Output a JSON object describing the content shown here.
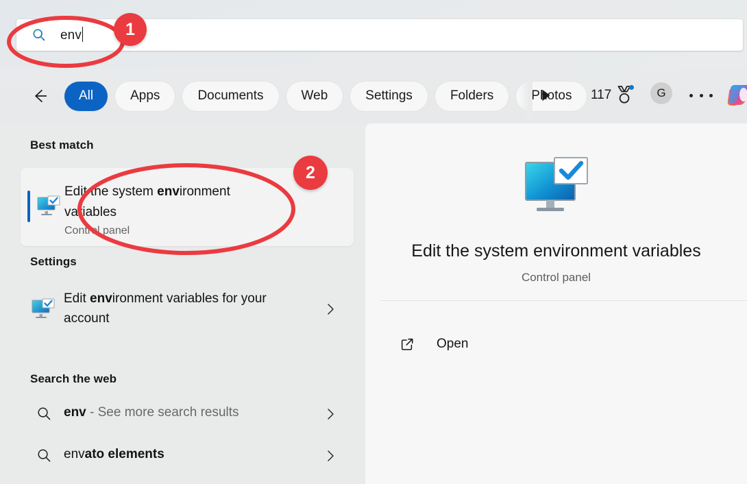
{
  "search": {
    "icon": "search-icon",
    "value": "env",
    "caret_visible": true
  },
  "tabs": {
    "back_icon": "back-arrow-icon",
    "items": [
      {
        "label": "All",
        "active": true
      },
      {
        "label": "Apps",
        "active": false
      },
      {
        "label": "Documents",
        "active": false
      },
      {
        "label": "Web",
        "active": false
      },
      {
        "label": "Settings",
        "active": false
      },
      {
        "label": "Folders",
        "active": false
      },
      {
        "label": "Photos",
        "active": false
      }
    ],
    "scroll_next_icon": "play-right-arrow-icon",
    "rewards": {
      "count": "117",
      "icon": "rewards-medal-icon",
      "has_notification_dot": true
    },
    "avatar": {
      "initial": "G",
      "icon": "avatar"
    },
    "more_icon": "ellipsis-icon",
    "copilot_icon": "copilot-icon"
  },
  "results": {
    "best_match": {
      "heading": "Best match",
      "title_prefix": "Edit the system ",
      "title_bold": "env",
      "title_suffix": "ironment variables",
      "title_full": "Edit the system environment variables",
      "subtitle": "Control panel",
      "icon": "control-panel-monitor-icon",
      "selected": true
    },
    "settings": {
      "heading": "Settings",
      "items": [
        {
          "title_prefix": "Edit ",
          "title_bold": "env",
          "title_suffix": "ironment variables for your account",
          "title_full": "Edit environment variables for your account",
          "icon": "control-panel-monitor-icon",
          "chevron": "chevron-right-icon"
        }
      ]
    },
    "web": {
      "heading": "Search the web",
      "items": [
        {
          "query": "env",
          "suffix": " - See more search results",
          "bold_part": "env",
          "rest": "",
          "icon": "magnifier-icon",
          "chevron": "chevron-right-icon"
        },
        {
          "query": "envato elements",
          "suffix": "",
          "bold_part": "env",
          "rest": "ato elements",
          "icon": "magnifier-icon",
          "chevron": "chevron-right-icon"
        }
      ]
    }
  },
  "preview": {
    "icon": "control-panel-monitor-icon",
    "title": "Edit the system environment variables",
    "subtitle": "Control panel",
    "actions": [
      {
        "label": "Open",
        "icon": "open-external-icon"
      }
    ]
  },
  "annotations": {
    "badges": [
      {
        "label": "1",
        "target": "search-box"
      },
      {
        "label": "2",
        "target": "best-match-card"
      }
    ],
    "ellipses": [
      {
        "target": "search-box"
      },
      {
        "target": "best-match-card"
      }
    ],
    "color": "#ea3b40"
  },
  "colors": {
    "accent_blue": "#0b64c4",
    "annotation_red": "#ea3b40",
    "panel_bg": "#f7f7f7",
    "body_bg": "#e9eaea"
  }
}
